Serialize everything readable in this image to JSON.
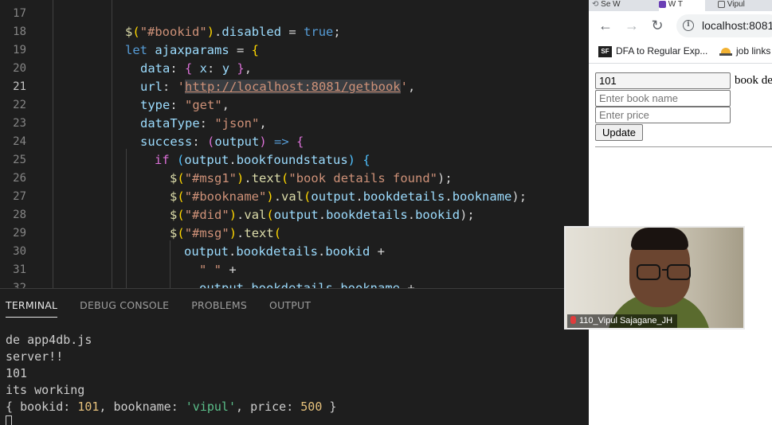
{
  "editor": {
    "lines": [
      {
        "n": "17",
        "active": false
      },
      {
        "n": "18",
        "active": false
      },
      {
        "n": "19",
        "active": false
      },
      {
        "n": "20",
        "active": false
      },
      {
        "n": "21",
        "active": true
      },
      {
        "n": "22",
        "active": false
      },
      {
        "n": "23",
        "active": false
      },
      {
        "n": "24",
        "active": false
      },
      {
        "n": "25",
        "active": false
      },
      {
        "n": "26",
        "active": false
      },
      {
        "n": "27",
        "active": false
      },
      {
        "n": "28",
        "active": false
      },
      {
        "n": "29",
        "active": false
      },
      {
        "n": "30",
        "active": false
      },
      {
        "n": "31",
        "active": false
      },
      {
        "n": "32",
        "active": false
      }
    ],
    "code": {
      "l18": {
        "a": "$",
        "b": "(",
        "c": "\"#bookid\"",
        "d": ")",
        "e": ".",
        "f": "disabled",
        "g": " = ",
        "h": "true",
        "i": ";"
      },
      "l19": {
        "a": "let ",
        "b": "ajaxparams",
        "c": " = ",
        "d": "{"
      },
      "l20": {
        "a": "data",
        "b": ": ",
        "c": "{",
        "d": " x",
        "e": ": ",
        "f": "y",
        "g": " }",
        "h": ","
      },
      "l21": {
        "a": "url",
        "b": ": ",
        "c": "'",
        "d": "http://localhost:8081/getbook",
        "e": "'",
        "f": ","
      },
      "l22": {
        "a": "type",
        "b": ": ",
        "c": "\"get\"",
        "d": ","
      },
      "l23": {
        "a": "dataType",
        "b": ": ",
        "c": "\"json\"",
        "d": ","
      },
      "l24": {
        "a": "success",
        "b": ": ",
        "c": "(",
        "d": "output",
        "e": ")",
        "f": " => ",
        "g": "{"
      },
      "l25": {
        "a": "if ",
        "b": "(",
        "c": "output",
        "d": ".",
        "e": "bookfoundstatus",
        "f": ")",
        "g": " {"
      },
      "l26": {
        "a": "$",
        "b": "(",
        "c": "\"#msg1\"",
        "d": ")",
        "e": ".",
        "f": "text",
        "g": "(",
        "h": "\"book details found\"",
        "i": ");"
      },
      "l27": {
        "a": "$",
        "b": "(",
        "c": "\"#bookname\"",
        "d": ")",
        "e": ".",
        "f": "val",
        "g": "(",
        "h": "output",
        "i": ".",
        "j": "bookdetails",
        "k": ".",
        "l": "bookname",
        "m": ");"
      },
      "l28": {
        "a": "$",
        "b": "(",
        "c": "\"#did\"",
        "d": ")",
        "e": ".",
        "f": "val",
        "g": "(",
        "h": "output",
        "i": ".",
        "j": "bookdetails",
        "k": ".",
        "l": "bookid",
        "m": ");"
      },
      "l29": {
        "a": "$",
        "b": "(",
        "c": "\"#msg\"",
        "d": ")",
        "e": ".",
        "f": "text",
        "g": "("
      },
      "l30": {
        "a": "output",
        "b": ".",
        "c": "bookdetails",
        "d": ".",
        "e": "bookid",
        "f": " +"
      },
      "l31": {
        "a": "\" \"",
        "b": " +"
      },
      "l32": {
        "a": "output",
        "b": ".",
        "c": "bookdetails",
        "d": ".",
        "e": "bookname",
        "f": " +"
      }
    }
  },
  "terminal": {
    "tabs": [
      "TERMINAL",
      "DEBUG CONSOLE",
      "PROBLEMS",
      "OUTPUT"
    ],
    "active_tab": "TERMINAL",
    "out1": "de app4db.js",
    "out2": "server!!",
    "out3": "101",
    "out4": "its working",
    "obj": {
      "open": "{ ",
      "k1": "bookid",
      "c1": ": ",
      "v1": "101",
      "s1": ", ",
      "k2": "bookname",
      "c2": ": ",
      "v2": "'vipul'",
      "s2": ", ",
      "k3": "price",
      "c3": ": ",
      "v3": "500",
      "close": " }"
    }
  },
  "browser": {
    "tabs": [
      "Se W",
      "W T",
      "Vipul"
    ],
    "url": "localhost:8081",
    "bookmarks": [
      {
        "icon": "salesforce-icon",
        "label": "DFA to Regular Exp..."
      },
      {
        "icon": "hat-icon",
        "label": "job links"
      }
    ],
    "form": {
      "bookid_value": "101",
      "bookname_placeholder": "Enter book name",
      "price_placeholder": "Enter price",
      "update_label": "Update",
      "msg_label": "book details found"
    }
  },
  "webcam": {
    "participant": "110_Vipul Sajagane_JH"
  },
  "colors": {
    "keyword": "#569cd6",
    "function": "#dcdcaa",
    "string": "#ce9178",
    "variable": "#9cdcfe",
    "editor_bg": "#1e1e1e"
  }
}
